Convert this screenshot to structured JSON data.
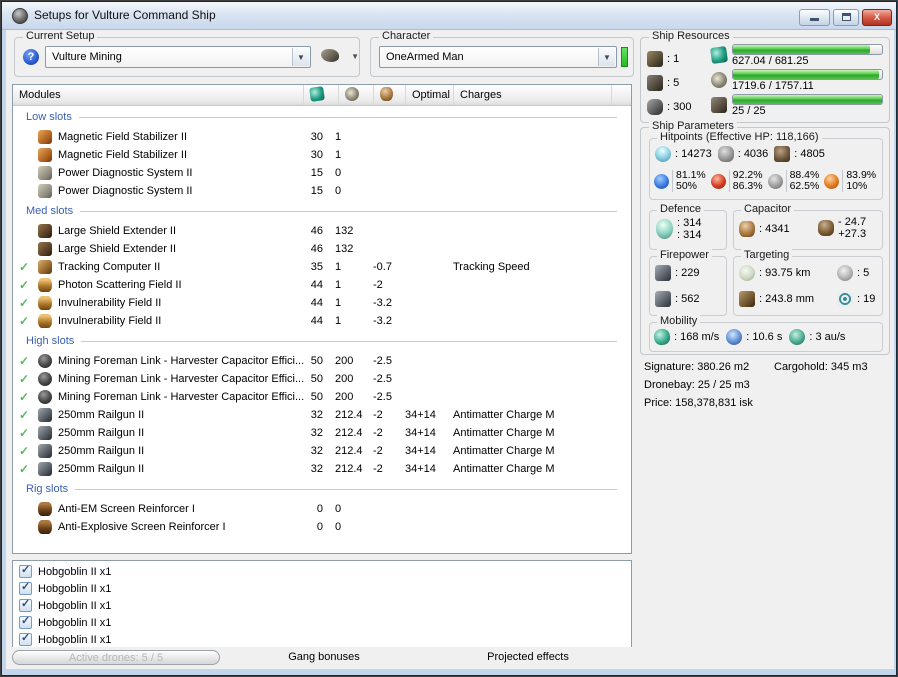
{
  "window": {
    "title": "Setups for Vulture Command Ship",
    "buttons": {
      "minimize": "minimize",
      "maximize": "maximize",
      "close": "X"
    }
  },
  "toolbar": {
    "current_setup": {
      "label": "Current Setup",
      "value": "Vulture Mining"
    },
    "character": {
      "label": "Character",
      "value": "OneArmed Man"
    }
  },
  "ship_resources": {
    "label": "Ship Resources",
    "turrets": ": 1",
    "launchers": ": 5",
    "calibration": ": 300",
    "cpu": {
      "text": "627.04 / 681.25",
      "pct": 92
    },
    "powergrid": {
      "text": "1719.6 / 1757.11",
      "pct": 98
    },
    "dronebay": {
      "text": "25 / 25",
      "pct": 100
    }
  },
  "ship_parameters": {
    "label": "Ship Parameters",
    "hitpoints": {
      "label": "Hitpoints (Effective HP: 118,166)",
      "shield": ": 14273",
      "armor": ": 4036",
      "structure": ": 4805",
      "resists": [
        {
          "icon": "em-resist-icon",
          "top": "81.1%",
          "bottom": "50%"
        },
        {
          "icon": "thermal-resist-icon",
          "top": "92.2%",
          "bottom": "86.3%"
        },
        {
          "icon": "kinetic-resist-icon",
          "top": "88.4%",
          "bottom": "62.5%"
        },
        {
          "icon": "explosive-resist-icon",
          "top": "83.9%",
          "bottom": "10%"
        }
      ]
    },
    "defence": {
      "label": "Defence",
      "value_top": ": 314",
      "value_bottom": ": 314"
    },
    "capacitor": {
      "label": "Capacitor",
      "amount": ": 4341",
      "delta_top": "- 24.7",
      "delta_bottom": "+27.3"
    },
    "firepower": {
      "label": "Firepower",
      "dps": ": 229",
      "volley": ": 562"
    },
    "targeting": {
      "label": "Targeting",
      "range": ": 93.75 km",
      "max_targets": ": 5",
      "scan_resolution": ": 243.8 mm",
      "sensor_strength": ": 19"
    },
    "mobility": {
      "label": "Mobility",
      "speed": ": 168 m/s",
      "align_time": ": 10.6 s",
      "warp_speed": ": 3 au/s"
    },
    "summary": {
      "signature": "Signature: 380.26 m2",
      "cargohold": "Cargohold: 345 m3",
      "dronebay": "Dronebay: 25 / 25 m3",
      "price": "Price: 158,378,831 isk"
    }
  },
  "modules": {
    "header": {
      "name": "Modules",
      "optimal": "Optimal",
      "charges": "Charges"
    },
    "sections": [
      {
        "title": "Low slots",
        "rows": [
          {
            "active": false,
            "icon": "magnetic-field-stabilizer-icon",
            "name": "Magnetic Field Stabilizer II",
            "cpu": "30",
            "pg": "1",
            "cap": "",
            "optimal": "",
            "charges": ""
          },
          {
            "active": false,
            "icon": "magnetic-field-stabilizer-icon",
            "name": "Magnetic Field Stabilizer II",
            "cpu": "30",
            "pg": "1",
            "cap": "",
            "optimal": "",
            "charges": ""
          },
          {
            "active": false,
            "icon": "power-diagnostic-system-icon",
            "name": "Power Diagnostic System II",
            "cpu": "15",
            "pg": "0",
            "cap": "",
            "optimal": "",
            "charges": ""
          },
          {
            "active": false,
            "icon": "power-diagnostic-system-icon",
            "name": "Power Diagnostic System II",
            "cpu": "15",
            "pg": "0",
            "cap": "",
            "optimal": "",
            "charges": ""
          }
        ]
      },
      {
        "title": "Med slots",
        "rows": [
          {
            "active": false,
            "icon": "shield-extender-icon",
            "name": "Large Shield Extender II",
            "cpu": "46",
            "pg": "132",
            "cap": "",
            "optimal": "",
            "charges": ""
          },
          {
            "active": false,
            "icon": "shield-extender-icon",
            "name": "Large Shield Extender II",
            "cpu": "46",
            "pg": "132",
            "cap": "",
            "optimal": "",
            "charges": ""
          },
          {
            "active": true,
            "icon": "tracking-computer-icon",
            "name": "Tracking Computer II",
            "cpu": "35",
            "pg": "1",
            "cap": "-0.7",
            "optimal": "",
            "charges": "Tracking Speed"
          },
          {
            "active": true,
            "icon": "shield-hardener-icon",
            "name": "Photon Scattering Field II",
            "cpu": "44",
            "pg": "1",
            "cap": "-2",
            "optimal": "",
            "charges": ""
          },
          {
            "active": true,
            "icon": "shield-hardener-icon",
            "name": "Invulnerability Field II",
            "cpu": "44",
            "pg": "1",
            "cap": "-3.2",
            "optimal": "",
            "charges": ""
          },
          {
            "active": true,
            "icon": "shield-hardener-icon",
            "name": "Invulnerability Field II",
            "cpu": "44",
            "pg": "1",
            "cap": "-3.2",
            "optimal": "",
            "charges": ""
          }
        ]
      },
      {
        "title": "High slots",
        "rows": [
          {
            "active": true,
            "icon": "gang-link-icon",
            "name": "Mining Foreman Link - Harvester Capacitor Effici...",
            "cpu": "50",
            "pg": "200",
            "cap": "-2.5",
            "optimal": "",
            "charges": ""
          },
          {
            "active": true,
            "icon": "gang-link-icon",
            "name": "Mining Foreman Link - Harvester Capacitor Effici...",
            "cpu": "50",
            "pg": "200",
            "cap": "-2.5",
            "optimal": "",
            "charges": ""
          },
          {
            "active": true,
            "icon": "gang-link-icon",
            "name": "Mining Foreman Link - Harvester Capacitor Effici...",
            "cpu": "50",
            "pg": "200",
            "cap": "-2.5",
            "optimal": "",
            "charges": ""
          },
          {
            "active": true,
            "icon": "railgun-icon",
            "name": "250mm Railgun II",
            "cpu": "32",
            "pg": "212.4",
            "cap": "-2",
            "optimal": "34+14",
            "charges": "Antimatter Charge M"
          },
          {
            "active": true,
            "icon": "railgun-icon",
            "name": "250mm Railgun II",
            "cpu": "32",
            "pg": "212.4",
            "cap": "-2",
            "optimal": "34+14",
            "charges": "Antimatter Charge M"
          },
          {
            "active": true,
            "icon": "railgun-icon",
            "name": "250mm Railgun II",
            "cpu": "32",
            "pg": "212.4",
            "cap": "-2",
            "optimal": "34+14",
            "charges": "Antimatter Charge M"
          },
          {
            "active": true,
            "icon": "railgun-icon",
            "name": "250mm Railgun II",
            "cpu": "32",
            "pg": "212.4",
            "cap": "-2",
            "optimal": "34+14",
            "charges": "Antimatter Charge M"
          }
        ]
      },
      {
        "title": "Rig slots",
        "rows": [
          {
            "active": false,
            "icon": "rig-icon",
            "name": "Anti-EM Screen Reinforcer I",
            "cpu": "0",
            "pg": "0",
            "cap": "",
            "optimal": "",
            "charges": ""
          },
          {
            "active": false,
            "icon": "rig-icon",
            "name": "Anti-Explosive Screen Reinforcer I",
            "cpu": "0",
            "pg": "0",
            "cap": "",
            "optimal": "",
            "charges": ""
          }
        ]
      }
    ]
  },
  "drones": {
    "items": [
      {
        "checked": true,
        "label": "Hobgoblin II x1"
      },
      {
        "checked": true,
        "label": "Hobgoblin II x1"
      },
      {
        "checked": true,
        "label": "Hobgoblin II x1"
      },
      {
        "checked": true,
        "label": "Hobgoblin II x1"
      },
      {
        "checked": true,
        "label": "Hobgoblin II x1"
      }
    ]
  },
  "footer": {
    "active_drones": "Active drones: 5 / 5",
    "gang_bonuses": "Gang bonuses",
    "projected_effects": "Projected effects"
  }
}
